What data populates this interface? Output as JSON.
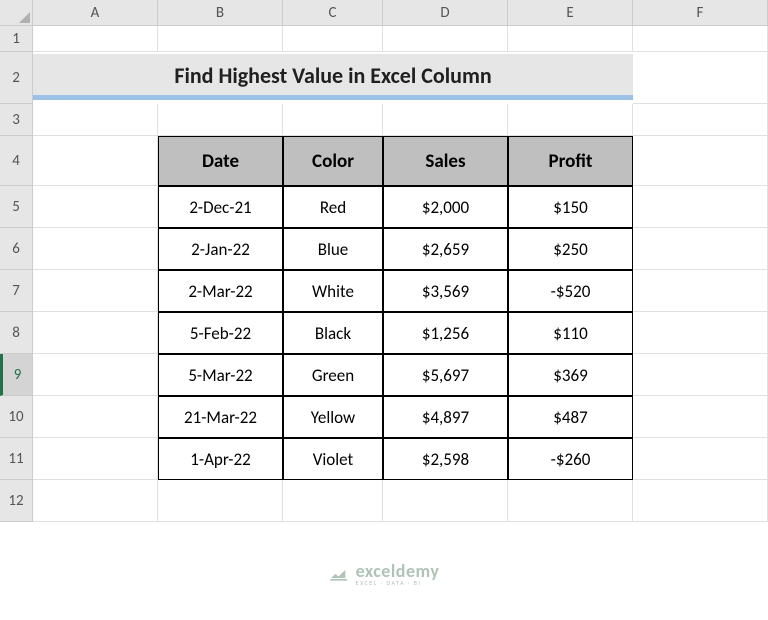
{
  "columns": [
    "A",
    "B",
    "C",
    "D",
    "E",
    "F"
  ],
  "rows": [
    "1",
    "2",
    "3",
    "4",
    "5",
    "6",
    "7",
    "8",
    "9",
    "10",
    "11",
    "12"
  ],
  "active_row": "9",
  "title": "Find Highest Value in Excel Column",
  "table": {
    "headers": [
      "Date",
      "Color",
      "Sales",
      "Profit"
    ],
    "data": [
      [
        "2-Dec-21",
        "Red",
        "$2,000",
        "$150"
      ],
      [
        "2-Jan-22",
        "Blue",
        "$2,659",
        "$250"
      ],
      [
        "2-Mar-22",
        "White",
        "$3,569",
        "-$520"
      ],
      [
        "5-Feb-22",
        "Black",
        "$1,256",
        "$110"
      ],
      [
        "5-Mar-22",
        "Green",
        "$5,697",
        "$369"
      ],
      [
        "21-Mar-22",
        "Yellow",
        "$4,897",
        "$487"
      ],
      [
        "1-Apr-22",
        "Violet",
        "$2,598",
        "-$260"
      ]
    ]
  },
  "watermark": {
    "main": "exceldemy",
    "sub": "EXCEL · DATA · BI"
  },
  "chart_data": {
    "type": "table",
    "title": "Find Highest Value in Excel Column",
    "columns": [
      "Date",
      "Color",
      "Sales",
      "Profit"
    ],
    "rows": [
      {
        "Date": "2-Dec-21",
        "Color": "Red",
        "Sales": 2000,
        "Profit": 150
      },
      {
        "Date": "2-Jan-22",
        "Color": "Blue",
        "Sales": 2659,
        "Profit": 250
      },
      {
        "Date": "2-Mar-22",
        "Color": "White",
        "Sales": 3569,
        "Profit": -520
      },
      {
        "Date": "5-Feb-22",
        "Color": "Black",
        "Sales": 1256,
        "Profit": 110
      },
      {
        "Date": "5-Mar-22",
        "Color": "Green",
        "Sales": 5697,
        "Profit": 369
      },
      {
        "Date": "21-Mar-22",
        "Color": "Yellow",
        "Sales": 4897,
        "Profit": 487
      },
      {
        "Date": "1-Apr-22",
        "Color": "Violet",
        "Sales": 2598,
        "Profit": -260
      }
    ]
  }
}
